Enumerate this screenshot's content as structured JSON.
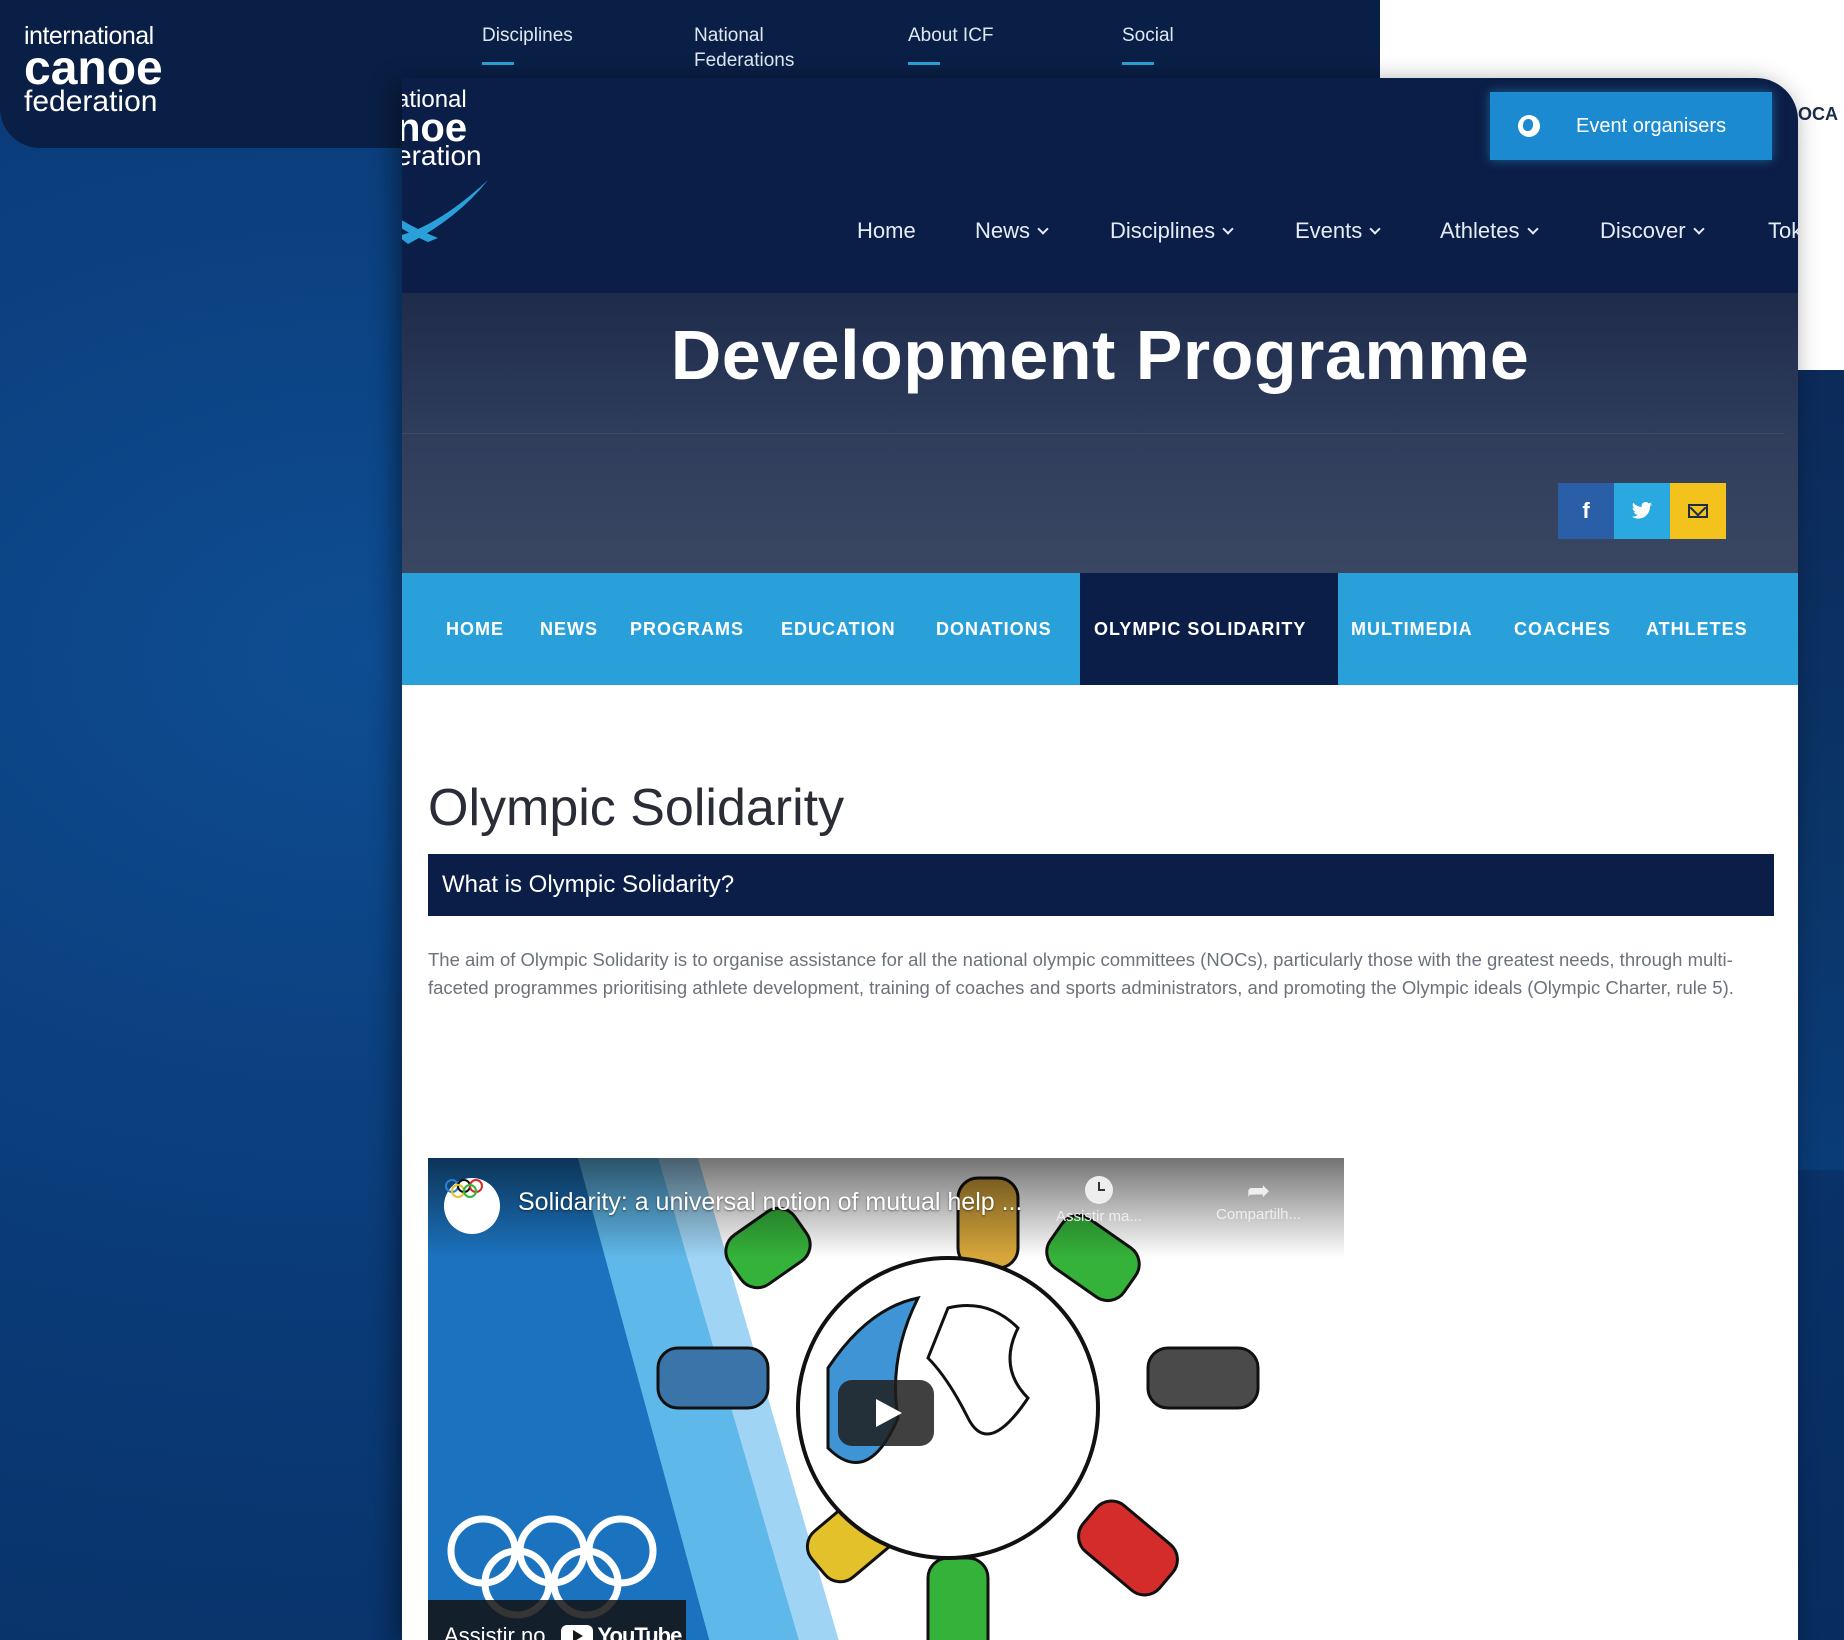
{
  "background_site": {
    "logo": {
      "line1": "international",
      "line2": "canoe",
      "line3": "federation"
    },
    "nav": [
      "Disciplines",
      "National Federations",
      "About ICF",
      "Social"
    ],
    "side_label": "OCA"
  },
  "window": {
    "logo": {
      "line1": "ational",
      "line2": "noe",
      "line3": "eration"
    },
    "event_button": "Event organisers",
    "nav": [
      "Home",
      "News",
      "Disciplines",
      "Events",
      "Athletes",
      "Discover",
      "Tok"
    ],
    "hero_title": "Development Programme",
    "share_icons": [
      "facebook-icon",
      "twitter-icon",
      "email-icon"
    ],
    "subnav": [
      "HOME",
      "NEWS",
      "PROGRAMS",
      "EDUCATION",
      "DONATIONS",
      "OLYMPIC SOLIDARITY",
      "MULTIMEDIA",
      "COACHES",
      "ATHLETES"
    ],
    "subnav_active": "OLYMPIC SOLIDARITY",
    "page_heading": "Olympic Solidarity",
    "section_title": "What is Olympic Solidarity?",
    "paragraph": "The aim of Olympic Solidarity is to organise assistance for all the national olympic committees (NOCs), particularly those with the greatest needs, through multi-faceted programmes prioritising athlete development, training of coaches and sports administrators, and promoting the Olympic ideals (Olympic Charter, rule 5).",
    "video": {
      "title": "Solidarity: a universal notion of mutual help ...",
      "watch_later": "Assistir ma...",
      "share": "Compartilh...",
      "watch_on": "Assistir no",
      "platform": "YouTube"
    }
  },
  "colors": {
    "navy": "#0b1e47",
    "accent_blue": "#2aa0db",
    "facebook": "#2a5fa8",
    "twitter": "#2aa9e0",
    "email": "#f4c21c"
  }
}
